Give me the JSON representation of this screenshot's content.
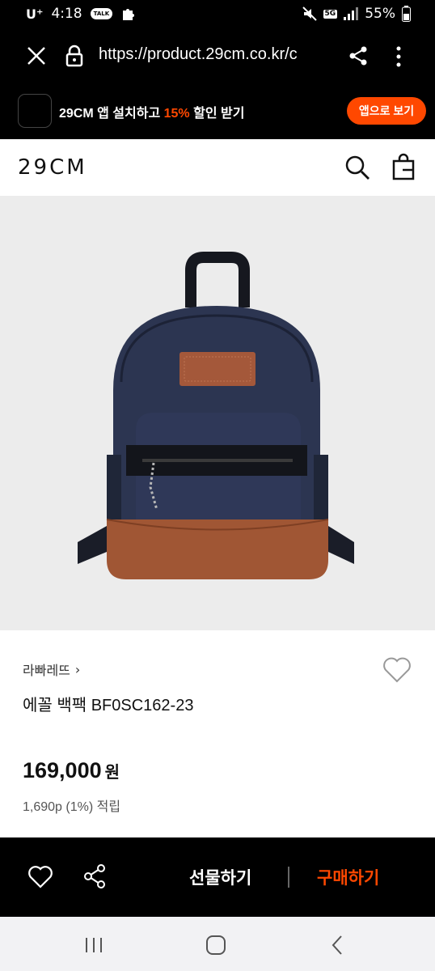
{
  "status_bar": {
    "carrier": "U⁺",
    "time": "4:18",
    "notif_talk": "TALK",
    "network": "5G",
    "battery": "55%"
  },
  "browser": {
    "url": "https://product.29cm.co.kr/c"
  },
  "promo": {
    "prefix": "29CM 앱 설치하고 ",
    "accent": "15%",
    "suffix": " 할인 받기",
    "button": "앱으로 보기",
    "accent_color": "#ff4800"
  },
  "header": {
    "logo": "29CM"
  },
  "product": {
    "brand": "라빠레뜨",
    "brand_chevron": "›",
    "name": "에꼴 백팩 BF0SC162-23",
    "price": "169,000",
    "currency": "원",
    "points": "1,690p (1%) 적립",
    "image_bg": "#ececec"
  },
  "bottom_bar": {
    "gift": "선물하기",
    "buy": "구매하기",
    "buy_color": "#ff4800"
  },
  "icons": [
    "close-icon",
    "lock-icon",
    "share-icon",
    "more-menu-icon",
    "search-icon",
    "bag-icon",
    "heart-icon",
    "recent-apps-icon",
    "home-icon",
    "back-icon"
  ]
}
